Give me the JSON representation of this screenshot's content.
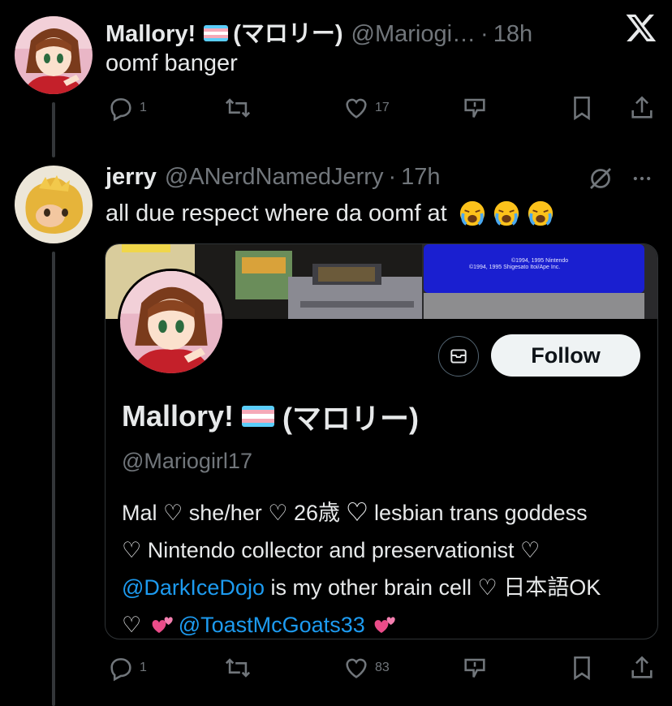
{
  "tweet1": {
    "display_name": "Mallory!",
    "display_name_suffix": "(マロリー)",
    "handle": "@Mariogi…",
    "separator": "·",
    "time": "18h",
    "text": "oomf banger",
    "replies": "1",
    "retweets": "",
    "likes": "17"
  },
  "tweet2": {
    "display_name": "jerry",
    "handle": "@ANerdNamedJerry",
    "separator": "·",
    "time": "17h",
    "text": "all due respect where da oomf at",
    "replies": "1",
    "retweets": "",
    "likes": "83"
  },
  "card": {
    "banner_text_line1": "©1994, 1995 Nintendo",
    "banner_text_line2": "©1994, 1995 Shigesato Itoi/Ape Inc.",
    "follow_label": "Follow",
    "display_name": "Mallory!",
    "display_name_suffix": "(マロリー)",
    "handle": "@Mariogirl17",
    "bio": {
      "line1": "Mal ♡ she/her ♡ 26歳 ♡ lesbian trans goddess",
      "line2": "♡ Nintendo collector and preservationist ♡",
      "line3_link": "@DarkIceDojo",
      "line3_rest": " is my other brain cell ♡ 日本語OK",
      "line4_prefix": "♡ ",
      "line4_link": "@ToastMcGoats33"
    }
  },
  "colors": {
    "background": "#000000",
    "text": "#e7e9ea",
    "muted": "#71767b",
    "link": "#1d9bf0",
    "border": "#2f3336"
  },
  "icons": [
    "x-logo-icon",
    "reply-icon",
    "retweet-icon",
    "like-icon",
    "community-notes-icon",
    "bookmark-icon",
    "share-icon",
    "muted-icon",
    "more-icon",
    "message-icon",
    "crying-emoji-icon",
    "two-hearts-emoji-icon",
    "trans-flag-icon"
  ]
}
